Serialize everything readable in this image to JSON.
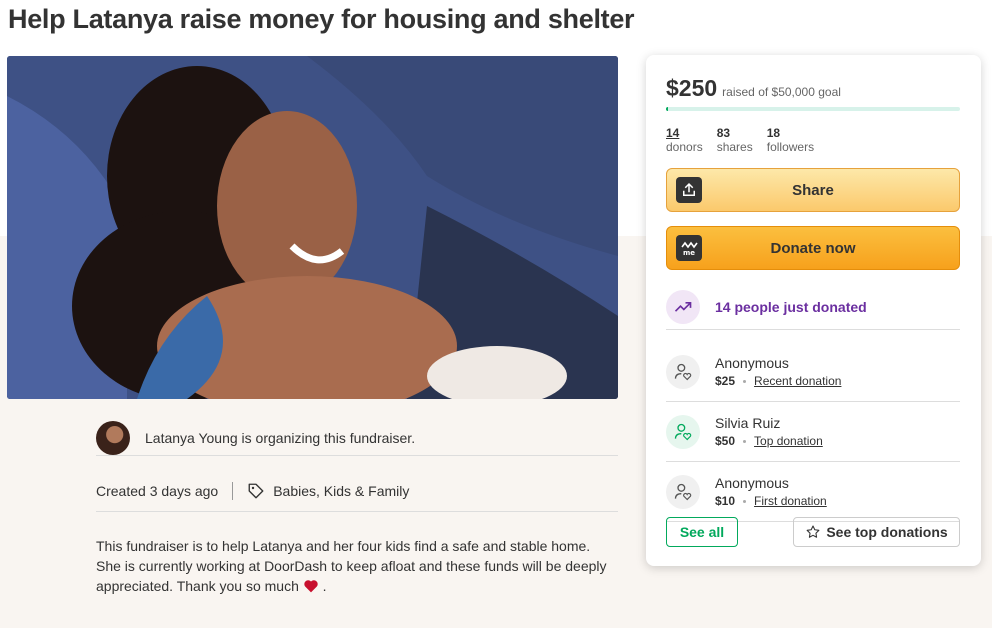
{
  "page": {
    "title": "Help Latanya raise money for housing and shelter"
  },
  "organizer": {
    "text": "Latanya Young is organizing this fundraiser."
  },
  "meta": {
    "created": "Created 3 days ago",
    "category": "Babies, Kids & Family"
  },
  "description": {
    "text": "This fundraiser is to help Latanya and her four kids find a safe and stable home. She is currently working at DoorDash to keep afloat and these funds will be deeply appreciated. Thank you so much",
    "end": "."
  },
  "card": {
    "raised_amount": "$250",
    "raised_goal": "raised of $50,000 goal",
    "progress_fraction": 0.005,
    "stats": [
      {
        "num": "14",
        "label": "donors"
      },
      {
        "num": "83",
        "label": "shares"
      },
      {
        "num": "18",
        "label": "followers"
      }
    ],
    "share_label": "Share",
    "donate_label": "Donate now",
    "trend_text": "14 people just donated",
    "donations": [
      {
        "name": "Anonymous",
        "amount": "$25",
        "tag": "Recent donation"
      },
      {
        "name": "Silvia Ruiz",
        "amount": "$50",
        "tag": "Top donation"
      },
      {
        "name": "Anonymous",
        "amount": "$10",
        "tag": "First donation"
      }
    ],
    "see_all_label": "See all",
    "see_top_label": "See top donations"
  },
  "colors": {
    "brand_green": "#02a95c",
    "donate_orange": "#f7a11c",
    "trend_purple": "#6b2fa0"
  },
  "icons": {
    "share": "share-icon",
    "donate": "gofundme-logo-icon",
    "trend": "trending-up-icon",
    "donor": "donor-heart-icon",
    "tag": "tag-icon",
    "star": "star-icon"
  }
}
